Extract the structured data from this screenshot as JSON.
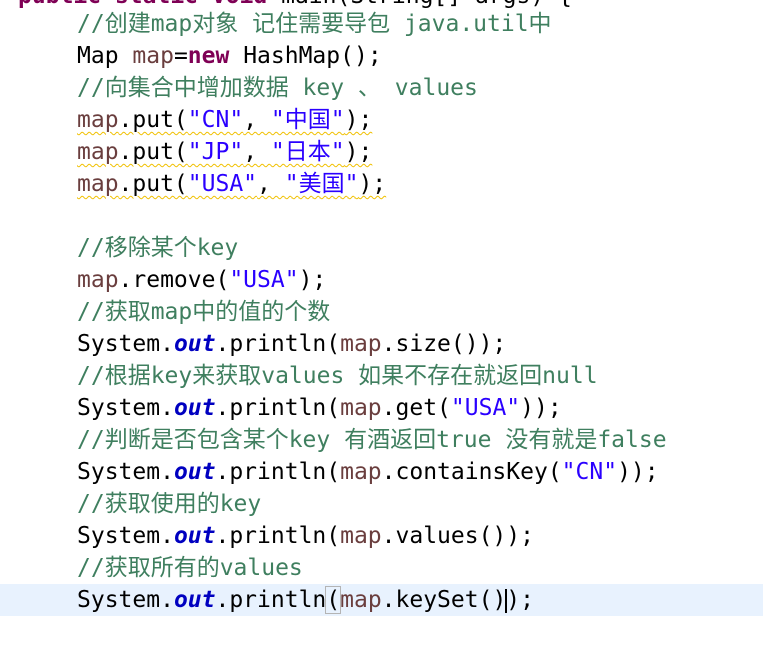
{
  "editor": {
    "top_partial_line": {
      "modifiers": "public static void",
      "method": " main(String[] args) {"
    },
    "lines": {
      "c1": "//创建map对象 记住需要导包 java.util中",
      "l2_type": "Map ",
      "l2_var": "map",
      "l2_eq": "=",
      "l2_kw": "new",
      "l2_rest": " HashMap();",
      "c3": "//向集合中增加数据 key 、 values",
      "put1_recv": "map",
      "put1_call": ".put(",
      "put1_key": "\"CN\"",
      "put1_sep": ", ",
      "put1_val": "\"中国\"",
      "put1_end": ");",
      "put2_recv": "map",
      "put2_call": ".put(",
      "put2_key": "\"JP\"",
      "put2_sep": ", ",
      "put2_val": "\"日本\"",
      "put2_end": ");",
      "put3_recv": "map",
      "put3_call": ".put(",
      "put3_key": "\"USA\"",
      "put3_sep": ", ",
      "put3_val": "\"美国\"",
      "put3_end": ");",
      "c9": "//移除某个key",
      "l10_recv": "map",
      "l10_call": ".remove(",
      "l10_arg": "\"USA\"",
      "l10_end": ");",
      "c11": "//获取map中的值的个数",
      "l12_a": "System.",
      "l12_out": "out",
      "l12_b": ".println(",
      "l12_var": "map",
      "l12_c": ".size());",
      "c13": "//根据key来获取values 如果不存在就返回null",
      "l14_a": "System.",
      "l14_out": "out",
      "l14_b": ".println(",
      "l14_var": "map",
      "l14_c": ".get(",
      "l14_arg": "\"USA\"",
      "l14_d": "));",
      "c15": "//判断是否包含某个key 有酒返回true 没有就是false",
      "l16_a": "System.",
      "l16_out": "out",
      "l16_b": ".println(",
      "l16_var": "map",
      "l16_c": ".containsKey(",
      "l16_arg": "\"CN\"",
      "l16_d": "));",
      "c17": "//获取使用的key",
      "l18_a": "System.",
      "l18_out": "out",
      "l18_b": ".println(",
      "l18_var": "map",
      "l18_c": ".values());",
      "c19": "//获取所有的values",
      "l20_a": "System.",
      "l20_out": "out",
      "l20_b": ".println",
      "l20_paren": "(",
      "l20_var": "map",
      "l20_c": ".keySet()",
      "l20_d": ");"
    }
  },
  "colors": {
    "comment": "#3f7f5f",
    "keyword": "#7f0055",
    "string": "#2a00ff",
    "static_field": "#0000c0",
    "local_variable": "#6a3e3e",
    "current_line_highlight": "#e8f2fe",
    "warning_underline": "#f0c000"
  }
}
